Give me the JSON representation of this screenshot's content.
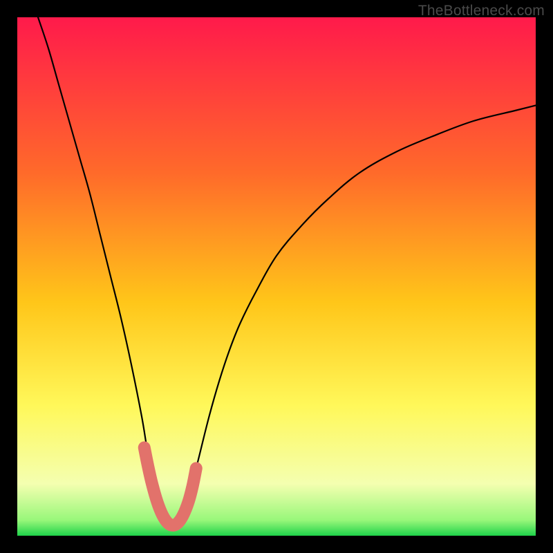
{
  "watermark": "TheBottleneck.com",
  "chart_data": {
    "type": "line",
    "title": "",
    "xlabel": "",
    "ylabel": "",
    "xlim": [
      0,
      100
    ],
    "ylim": [
      0,
      100
    ],
    "series": [
      {
        "name": "bottleneck-curve",
        "x": [
          4,
          6,
          8,
          10,
          12,
          14,
          16,
          18,
          20,
          22,
          24,
          25,
          26,
          27,
          28,
          29,
          30,
          31,
          32,
          33,
          34,
          35,
          37,
          39,
          41,
          43,
          46,
          50,
          55,
          60,
          66,
          73,
          80,
          88,
          96,
          100
        ],
        "y": [
          100,
          94,
          87,
          80,
          73,
          66,
          58,
          50,
          42,
          33,
          23,
          17,
          12,
          7,
          4,
          2,
          1,
          2,
          4,
          7,
          11,
          15,
          23,
          30,
          36,
          41,
          47,
          54,
          60,
          65,
          70,
          74,
          77,
          80,
          82,
          83
        ]
      },
      {
        "name": "highlight-band",
        "x": [
          24.5,
          25.2,
          26,
          27,
          28,
          29,
          30,
          31,
          32,
          33,
          33.8,
          34.5
        ],
        "y": [
          17,
          13.5,
          10,
          6.5,
          4,
          2.5,
          2,
          2.5,
          4,
          6.5,
          9.5,
          13
        ]
      }
    ],
    "gradient_stops": [
      {
        "offset": 0,
        "color": "#ff1a4b"
      },
      {
        "offset": 30,
        "color": "#ff6a2a"
      },
      {
        "offset": 55,
        "color": "#ffc619"
      },
      {
        "offset": 75,
        "color": "#fff85a"
      },
      {
        "offset": 90,
        "color": "#f4ffb0"
      },
      {
        "offset": 97,
        "color": "#98f77a"
      },
      {
        "offset": 100,
        "color": "#1fd34a"
      }
    ],
    "highlight_color": "#e2726b",
    "curve_color": "#000000"
  }
}
